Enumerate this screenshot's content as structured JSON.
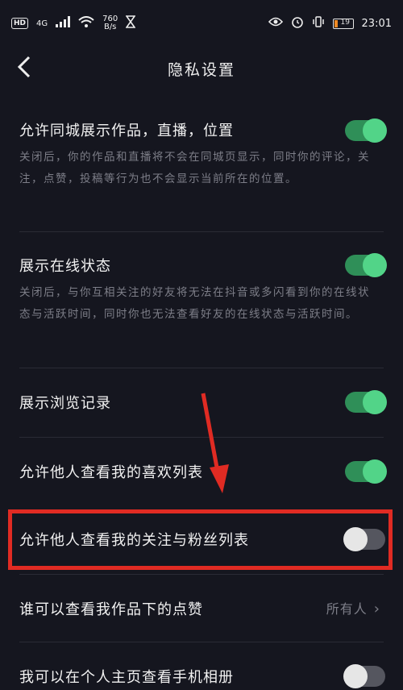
{
  "status_bar": {
    "hd": "HD",
    "network": "4G",
    "speed_value": "760",
    "speed_unit": "B/s",
    "battery": "19",
    "time": "23:01"
  },
  "nav": {
    "title": "隐私设置"
  },
  "settings": [
    {
      "label": "允许同城展示作品，直播，位置",
      "desc": "关闭后，你的作品和直播将不会在同城页显示，同时你的评论，关注，点赞，投稿等行为也不会显示当前所在的位置。",
      "enabled": true
    },
    {
      "label": "展示在线状态",
      "desc": "关闭后，与你互相关注的好友将无法在抖音或多闪看到你的在线状态与活跃时间，同时你也无法查看好友的在线状态与活跃时间。",
      "enabled": true
    },
    {
      "label": "展示浏览记录",
      "enabled": true
    },
    {
      "label": "允许他人查看我的喜欢列表",
      "enabled": true
    },
    {
      "label": "允许他人查看我的关注与粉丝列表",
      "enabled": false
    },
    {
      "label": "谁可以查看我作品下的点赞",
      "value": "所有人"
    },
    {
      "label": "我可以在个人主页查看手机相册",
      "enabled": false
    }
  ],
  "colors": {
    "background": "#15161f",
    "toggle_on": "#52d488",
    "annotation": "#e02b23"
  }
}
